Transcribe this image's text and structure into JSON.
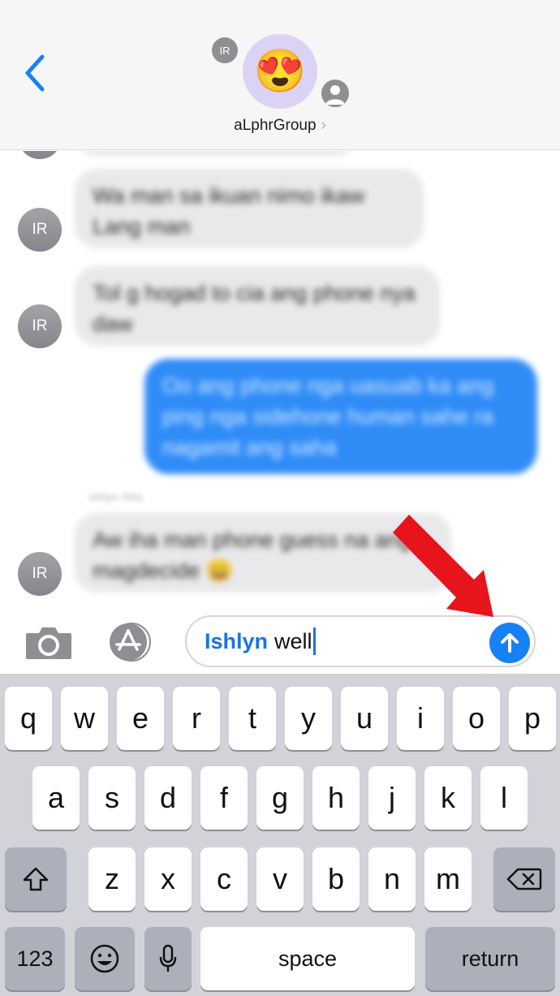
{
  "header": {
    "small_avatar_initials": "IR",
    "group_emoji": "😍",
    "group_name": "aLphrGroup",
    "chevron": "›"
  },
  "chat": {
    "messages": [
      {
        "direction": "incoming",
        "sender": "IR",
        "text": "Wa man sa ikuan nimo ikaw Lang man"
      },
      {
        "direction": "incoming",
        "sender": "IR",
        "text": "Tol g hogad to cia ang phone nya daw"
      },
      {
        "direction": "outgoing",
        "text": "Oo ang phone nga uasuab ka ang ping nga sidehone human sahe ra nagamit ang saha"
      },
      {
        "direction": "incoming",
        "sender": "IR",
        "text": "Aw iha man phone guess na ang magdecide 😀"
      }
    ],
    "timestamp": "Ishlyn Rita",
    "avatar_initials": "IR"
  },
  "composer": {
    "mention": "Ishlyn",
    "typed_text": "well"
  },
  "keyboard": {
    "row1": [
      "q",
      "w",
      "e",
      "r",
      "t",
      "y",
      "u",
      "i",
      "o",
      "p"
    ],
    "row2": [
      "a",
      "s",
      "d",
      "f",
      "g",
      "h",
      "j",
      "k",
      "l"
    ],
    "row3": [
      "z",
      "x",
      "c",
      "v",
      "b",
      "n",
      "m"
    ],
    "numbers_key": "123",
    "space_key": "space",
    "return_key": "return"
  },
  "colors": {
    "accent": "#1681f6",
    "outgoing_bubble": "#2f8cf7",
    "incoming_bubble": "#e9e9eb",
    "annotation_arrow": "#e8141b",
    "keyboard_bg": "#d1d3d9"
  },
  "icons": [
    "back-chevron-icon",
    "person-icon",
    "camera-icon",
    "app-store-icon",
    "send-arrow-icon",
    "shift-icon",
    "delete-icon",
    "emoji-icon",
    "microphone-icon"
  ]
}
